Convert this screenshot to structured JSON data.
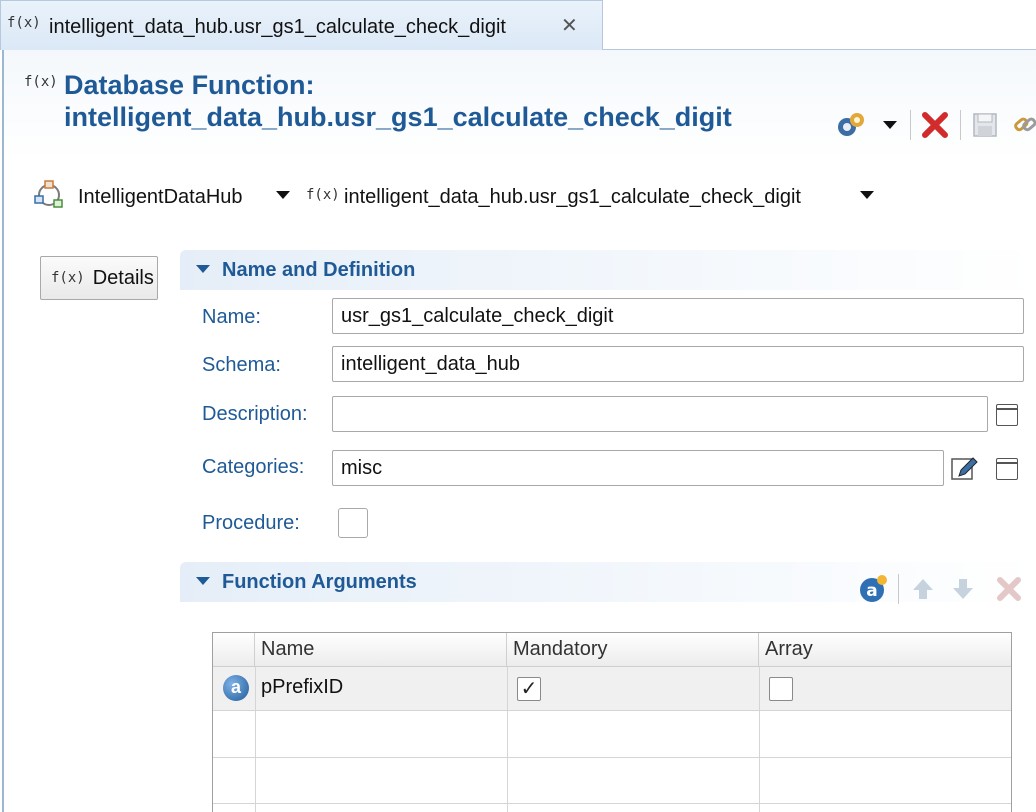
{
  "tab": {
    "icon": "function-icon",
    "icon_text": "f(x)",
    "title": "intelligent_data_hub.usr_gs1_calculate_check_digit",
    "close_glyph": "✕"
  },
  "header": {
    "icon_text": "f(x)",
    "title_line1": "Database Function:",
    "title_line2": "intelligent_data_hub.usr_gs1_calculate_check_digit"
  },
  "toolbar": {
    "items": [
      "gears-icon",
      "chevron-down-icon",
      "delete-icon",
      "save-icon",
      "link-icon"
    ]
  },
  "breadcrumb": {
    "project": "IntelligentDataHub",
    "function_icon_text": "f(x)",
    "function": "intelligent_data_hub.usr_gs1_calculate_check_digit"
  },
  "sidebar": {
    "details_icon_text": "f(x)",
    "details_label": "Details"
  },
  "name_section": {
    "title": "Name and Definition",
    "name_label": "Name:",
    "name_value": "usr_gs1_calculate_check_digit",
    "schema_label": "Schema:",
    "schema_value": "intelligent_data_hub",
    "description_label": "Description:",
    "description_value": "",
    "categories_label": "Categories:",
    "categories_value": "misc",
    "procedure_label": "Procedure:",
    "procedure_checked": false
  },
  "arguments_section": {
    "title": "Function Arguments",
    "columns": [
      "Name",
      "Mandatory",
      "Array"
    ],
    "rows": [
      {
        "badge": "a",
        "name": "pPrefixID",
        "mandatory": "✓",
        "array": ""
      }
    ]
  },
  "colors": {
    "accent": "#1f5a96",
    "delete": "#d22b2b"
  }
}
